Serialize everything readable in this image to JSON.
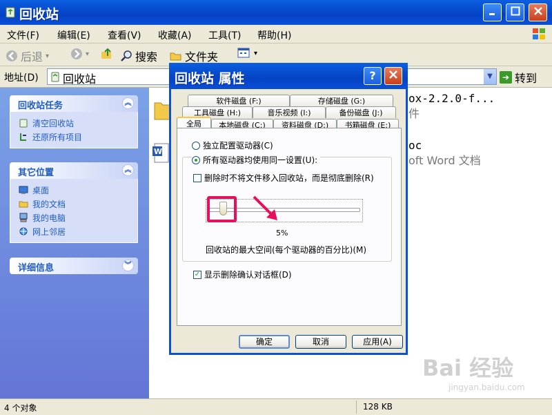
{
  "window": {
    "title": "回收站"
  },
  "menu": [
    "文件(F)",
    "编辑(E)",
    "查看(V)",
    "收藏(A)",
    "工具(T)",
    "帮助(H)"
  ],
  "toolbar": {
    "back": "后退",
    "search": "搜索",
    "folders": "文件夹"
  },
  "address": {
    "label": "地址(D)",
    "value": "回收站",
    "go": "转到"
  },
  "panels": [
    {
      "title": "回收站任务",
      "items": [
        "清空回收站",
        "还原所有项目"
      ]
    },
    {
      "title": "其它位置",
      "items": [
        "桌面",
        "我的文档",
        "我的电脑",
        "网上邻居"
      ]
    },
    {
      "title": "详细信息",
      "items": []
    }
  ],
  "files": {
    "file1_name": "ox-2.2.0-f...",
    "file1_type": "件",
    "file2_name": "oc",
    "file2_type": "oft Word 文档"
  },
  "status": {
    "objects": "4 个对象",
    "size": "128 KB"
  },
  "watermark": {
    "brand": "Bai 经验",
    "url": "jingyan.baidu.com"
  },
  "dialog": {
    "title": "回收站 属性",
    "help": "?",
    "tabs_row1": [
      "软件磁盘 (F:)",
      "存储磁盘 (G:)"
    ],
    "tabs_row2": [
      "工具磁盘 (H:)",
      "音乐视频 (I:)",
      "备份磁盘 (J:)"
    ],
    "tabs_row3": [
      "全局",
      "本地磁盘 (C:)",
      "资料磁盘 (D:)",
      "书箱磁盘 (E:)"
    ],
    "radio_independent": "独立配置驱动器(C)",
    "radio_same": "所有驱动器均使用同一设置(U):",
    "check_delete": "删除时不将文件移入回收站，而是彻底删除(R)",
    "slider_value_pct": 5,
    "slider_label": "5%",
    "slider_caption": "回收站的最大空间(每个驱动器的百分比)(M)",
    "check_confirm": "显示删除确认对话框(D)",
    "buttons": {
      "ok": "确定",
      "cancel": "取消",
      "apply": "应用(A)"
    }
  },
  "colors": {
    "xp_blue": "#0542C4",
    "highlight": "#E5115F",
    "arrow": "#E5115F"
  }
}
